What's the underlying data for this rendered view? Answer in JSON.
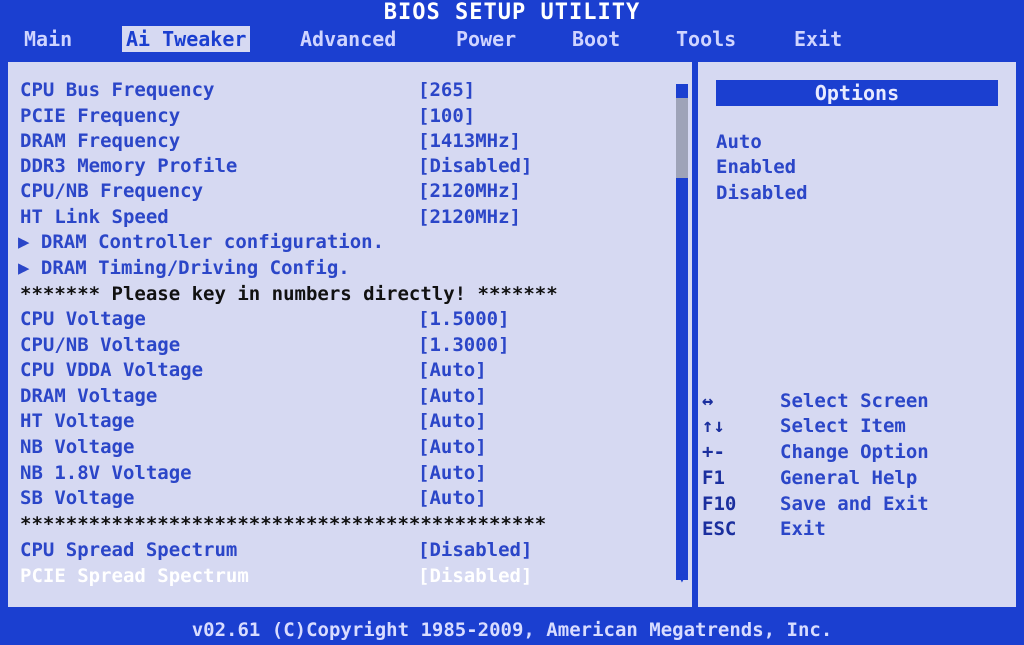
{
  "title": "BIOS SETUP UTILITY",
  "menu": [
    "Main",
    "Ai Tweaker",
    "Advanced",
    "Power",
    "Boot",
    "Tools",
    "Exit"
  ],
  "settings": [
    {
      "label": "CPU Bus Frequency",
      "value": "[265]"
    },
    {
      "label": "PCIE Frequency",
      "value": "[100]"
    },
    {
      "label": "DRAM Frequency",
      "value": "[1413MHz]"
    },
    {
      "label": "DDR3 Memory Profile",
      "value": "[Disabled]"
    },
    {
      "label": "CPU/NB Frequency",
      "value": "[2120MHz]"
    },
    {
      "label": "HT Link Speed",
      "value": "[2120MHz]"
    },
    {
      "label": "▶ DRAM Controller configuration.",
      "value": ""
    },
    {
      "label": "▶ DRAM Timing/Driving Config.",
      "value": ""
    },
    {
      "label": "******* Please key in numbers directly! *******",
      "value": ""
    },
    {
      "label": "CPU Voltage",
      "value": "[1.5000]"
    },
    {
      "label": "CPU/NB Voltage",
      "value": "[1.3000]"
    },
    {
      "label": "CPU VDDA Voltage",
      "value": "[Auto]"
    },
    {
      "label": "DRAM Voltage",
      "value": "[Auto]"
    },
    {
      "label": "HT Voltage",
      "value": "[Auto]"
    },
    {
      "label": "NB Voltage",
      "value": "[Auto]"
    },
    {
      "label": "NB 1.8V Voltage",
      "value": "[Auto]"
    },
    {
      "label": "SB Voltage",
      "value": "[Auto]"
    },
    {
      "label": "**********************************************",
      "value": ""
    },
    {
      "label": "CPU Spread Spectrum",
      "value": "[Disabled]"
    },
    {
      "label": "PCIE Spread Spectrum",
      "value": "[Disabled]"
    }
  ],
  "options": {
    "header": "Options",
    "items": [
      "Auto",
      "Enabled",
      "Disabled"
    ]
  },
  "keys": [
    {
      "key": "↔",
      "desc": "Select Screen"
    },
    {
      "key": "↑↓",
      "desc": "Select Item"
    },
    {
      "key": "+-",
      "desc": "Change Option"
    },
    {
      "key": "F1",
      "desc": "General Help"
    },
    {
      "key": "F10",
      "desc": "Save and Exit"
    },
    {
      "key": "ESC",
      "desc": "Exit"
    }
  ],
  "footer": "v02.61 (C)Copyright 1985-2009, American Megatrends, Inc."
}
